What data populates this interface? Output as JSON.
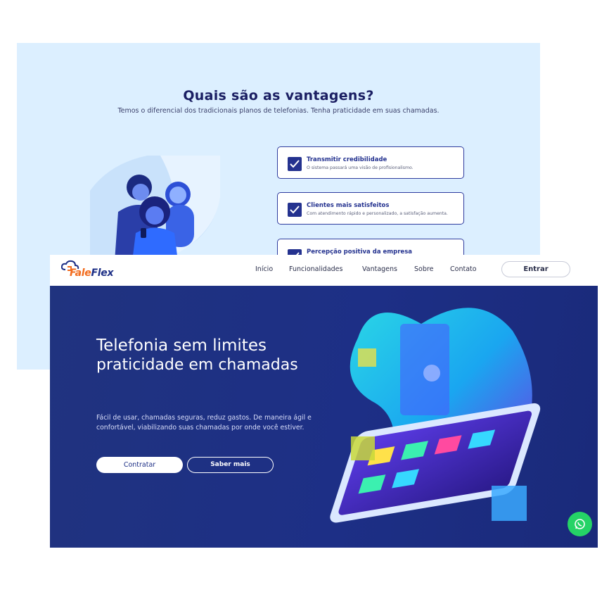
{
  "advantages": {
    "title": "Quais são as vantagens?",
    "subtitle": "Temos o diferencial dos tradicionais planos de telefonias. Tenha praticidade em suas chamadas.",
    "features": [
      {
        "title": "Transmitir credibilidade",
        "description": "O sistema passará uma visão de profisionalismo."
      },
      {
        "title": "Clientes mais satisfeitos",
        "description": "Com atendimento rápido e personalizado, a satisfação aumenta."
      },
      {
        "title": "Percepção positiva da empresa",
        "description": ""
      }
    ]
  },
  "nav": {
    "logo_prefix": "Fale",
    "logo_suffix": "Flex",
    "links": [
      "Início",
      "Funcionalidades",
      "Vantagens",
      "Sobre",
      "Contato"
    ],
    "login": "Entrar"
  },
  "hero": {
    "title_line1": "Telefonia sem limites",
    "title_line2": "praticidade em chamadas",
    "description": "Fácil de usar, chamadas seguras, reduz gastos. De maneira ágil e confortável, viabilizando suas chamadas por onde você estiver.",
    "primary_button": "Contratar",
    "secondary_button": "Saber mais"
  },
  "icons": {
    "check": "checkbox-check-icon",
    "whatsapp": "whatsapp-icon",
    "logo": "cloud-phone-logo-icon"
  },
  "colors": {
    "brand_blue": "#1d2f86",
    "accent_orange": "#f26b1d",
    "light_bg": "#dcefff",
    "whatsapp_green": "#25d366"
  }
}
